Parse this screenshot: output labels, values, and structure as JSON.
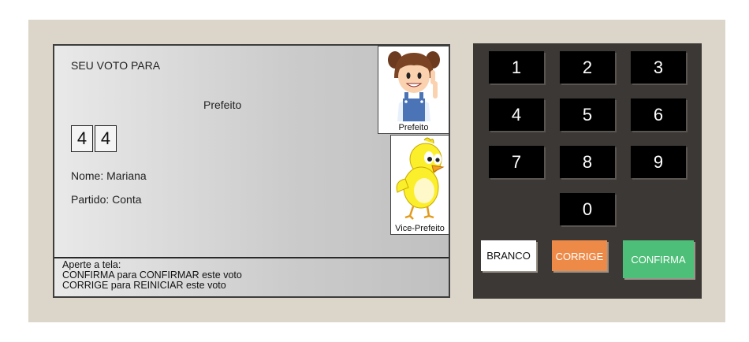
{
  "screen": {
    "heading": "SEU VOTO PARA",
    "office": "Prefeito",
    "digits": [
      "4",
      "4"
    ],
    "name_line": "Nome: Mariana",
    "party_line": "Partido: Conta",
    "photos": [
      {
        "caption": "Prefeito",
        "icon": "girl-candidate-icon"
      },
      {
        "caption": "Vice-Prefeito",
        "icon": "yellow-bird-icon"
      }
    ],
    "instructions": [
      "Aperte a tela:",
      "CONFIRMA para CONFIRMAR este voto",
      "CORRIGE para REINICIAR este voto"
    ]
  },
  "keypad": {
    "keys": [
      "1",
      "2",
      "3",
      "4",
      "5",
      "6",
      "7",
      "8",
      "9",
      "0"
    ],
    "branco": "BRANCO",
    "corrige": "CORRIGE",
    "confirma": "CONFIRMA"
  },
  "colors": {
    "branco": "#ffffff",
    "corrige": "#ee8a48",
    "confirma": "#4dbf78",
    "keypad_bg": "#3b3835",
    "machine_bg": "#dcd5ca"
  }
}
